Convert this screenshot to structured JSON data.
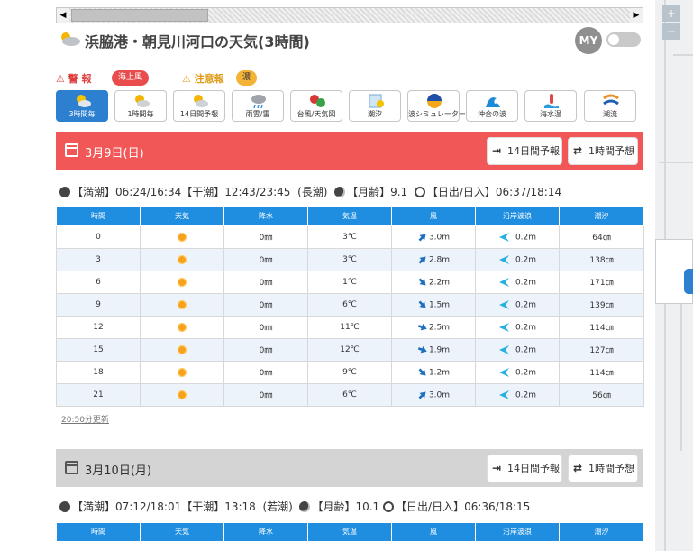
{
  "page_title": "浜脇港・朝見川河口の天気(3時間)",
  "my_label": "MY",
  "alerts": {
    "warning_label": "警 報",
    "warning_badge": "海上風",
    "caution_label": "注意報",
    "caution_badge": "濃"
  },
  "tabs": [
    {
      "label": "3時間毎",
      "icon": "sun-cloud-icon",
      "active": true
    },
    {
      "label": "1時間毎",
      "icon": "sun-cloud-icon",
      "active": false
    },
    {
      "label": "14日間予報",
      "icon": "sun-cloud-icon",
      "active": false
    },
    {
      "label": "雨雲/雷",
      "icon": "rain-cloud-icon",
      "active": false
    },
    {
      "label": "台風/天気図",
      "icon": "typhoon-icon",
      "active": false
    },
    {
      "label": "潮汐",
      "icon": "tide-icon",
      "active": false
    },
    {
      "label": "波シミュレーター",
      "icon": "wave-simulator-icon",
      "active": false
    },
    {
      "label": "沖合の波",
      "icon": "offshore-wave-icon",
      "active": false
    },
    {
      "label": "海水温",
      "icon": "sea-temp-icon",
      "active": false
    },
    {
      "label": "潮流",
      "icon": "tidal-current-icon",
      "active": false
    }
  ],
  "buttons": {
    "forecast_14": "14日間予報",
    "forecast_1h": "1時間予想"
  },
  "columns": [
    "時間",
    "天気",
    "降水",
    "気温",
    "風",
    "沿岸波浪",
    "潮汐"
  ],
  "colors": {
    "day1_header": "#f25758",
    "day2_header": "#d4d4d4",
    "table_header": "#1f8ee0",
    "wind_arrow": "#1f6fc0",
    "wave_arrow": "#25b0e0"
  },
  "days": [
    {
      "date": "3月9日(日)",
      "tide": {
        "high": "【満潮】06:24/16:34",
        "low": "【干潮】12:43/23:45",
        "type": "(長潮)",
        "moon": "【月齢】9.1",
        "sun": "【日出/日入】06:37/18:14"
      },
      "rows": [
        {
          "time": "0",
          "weather": "sun-icon",
          "precip": "0㎜",
          "temp": "3℃",
          "wind_dir": "northwest",
          "wind": "3.0m",
          "wave": "0.2m",
          "tide": "64㎝"
        },
        {
          "time": "3",
          "weather": "sun-icon",
          "precip": "0㎜",
          "temp": "3℃",
          "wind_dir": "northwest",
          "wind": "2.8m",
          "wave": "0.2m",
          "tide": "138㎝"
        },
        {
          "time": "6",
          "weather": "sun-icon",
          "precip": "0㎜",
          "temp": "1℃",
          "wind_dir": "northeast",
          "wind": "2.2m",
          "wave": "0.2m",
          "tide": "171㎝"
        },
        {
          "time": "9",
          "weather": "sun-icon",
          "precip": "0㎜",
          "temp": "6℃",
          "wind_dir": "northeast",
          "wind": "1.5m",
          "wave": "0.2m",
          "tide": "139㎝"
        },
        {
          "time": "12",
          "weather": "sun-icon",
          "precip": "0㎜",
          "temp": "11℃",
          "wind_dir": "east-northeast",
          "wind": "2.5m",
          "wave": "0.2m",
          "tide": "114㎝"
        },
        {
          "time": "15",
          "weather": "sun-icon",
          "precip": "0㎜",
          "temp": "12℃",
          "wind_dir": "east-northeast",
          "wind": "1.9m",
          "wave": "0.2m",
          "tide": "127㎝"
        },
        {
          "time": "18",
          "weather": "sun-icon",
          "precip": "0㎜",
          "temp": "9℃",
          "wind_dir": "northeast",
          "wind": "1.2m",
          "wave": "0.2m",
          "tide": "114㎝"
        },
        {
          "time": "21",
          "weather": "sun-icon",
          "precip": "0㎜",
          "temp": "6℃",
          "wind_dir": "northwest",
          "wind": "3.0m",
          "wave": "0.2m",
          "tide": "56㎝"
        }
      ],
      "updated": "20:50分更新"
    },
    {
      "date": "3月10日(月)",
      "tide": {
        "high": "【満潮】07:12/18:01",
        "low": "【干潮】13:18",
        "type": "(若潮)",
        "moon": "【月齢】10.1",
        "sun": "【日出/日入】06:36/18:15"
      }
    }
  ]
}
